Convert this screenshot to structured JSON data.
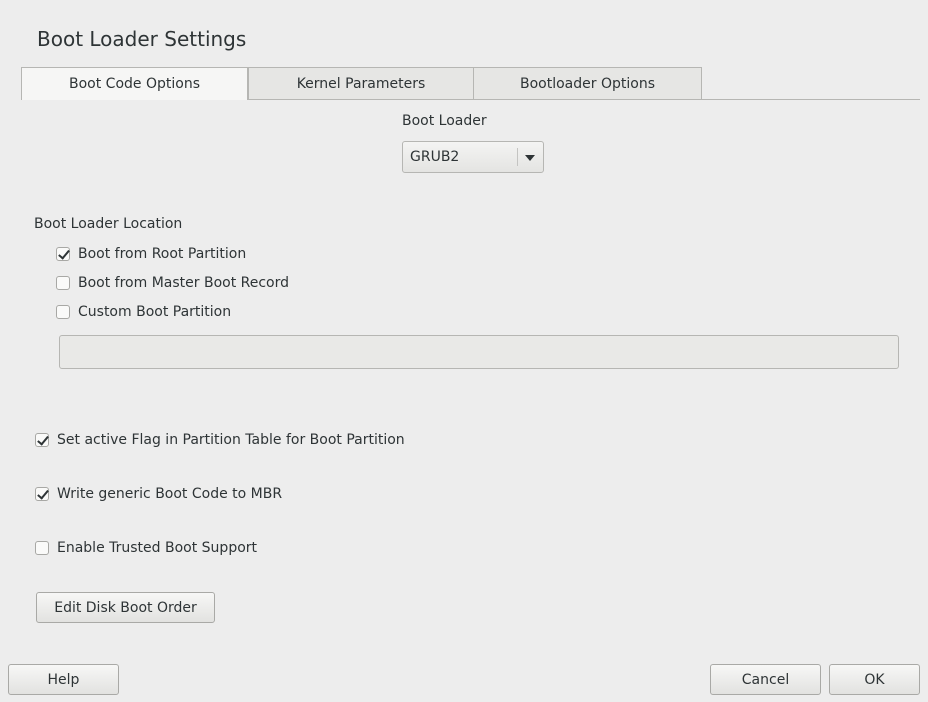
{
  "page": {
    "title": "Boot Loader Settings"
  },
  "tabs": [
    {
      "label": "Boot Code Options",
      "active": true
    },
    {
      "label": "Kernel Parameters",
      "active": false
    },
    {
      "label": "Bootloader Options",
      "active": false
    }
  ],
  "boot_loader": {
    "label": "Boot Loader",
    "value": "GRUB2"
  },
  "location": {
    "heading": "Boot Loader Location",
    "options": [
      {
        "label": "Boot from Root Partition",
        "checked": true
      },
      {
        "label": "Boot from Master Boot Record",
        "checked": false
      },
      {
        "label": "Custom Boot Partition",
        "checked": false
      }
    ],
    "custom_partition_value": ""
  },
  "options": [
    {
      "label": "Set active Flag in Partition Table for Boot Partition",
      "checked": true
    },
    {
      "label": "Write generic Boot Code to MBR",
      "checked": true
    },
    {
      "label": "Enable Trusted Boot Support",
      "checked": false
    }
  ],
  "buttons": {
    "edit_disk_boot_order": "Edit Disk Boot Order",
    "help": "Help",
    "cancel": "Cancel",
    "ok": "OK"
  }
}
